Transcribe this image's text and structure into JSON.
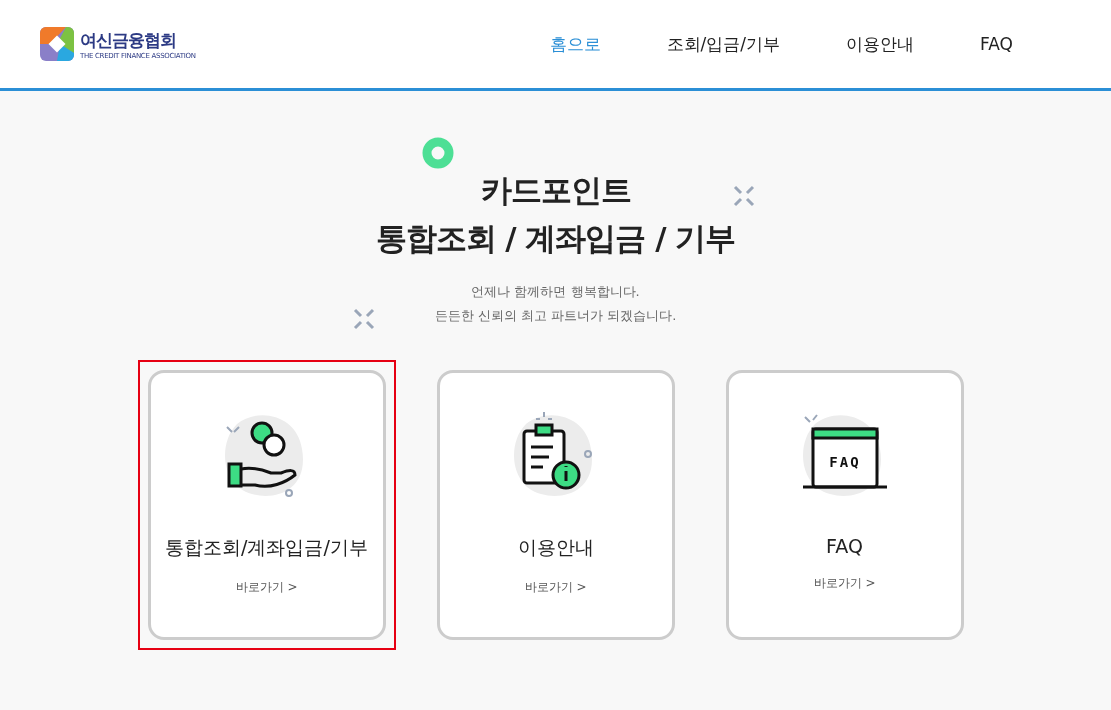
{
  "header": {
    "logo": {
      "name": "여신금융협회",
      "subtitle": "THE CREDIT FINANCE ASSOCIATION"
    },
    "nav": [
      {
        "label": "홈으로",
        "selected": true
      },
      {
        "label": "조회/입금/기부",
        "selected": false
      },
      {
        "label": "이용안내",
        "selected": false
      },
      {
        "label": "FAQ",
        "selected": false
      }
    ]
  },
  "hero": {
    "title_lines": [
      "카드포인트",
      "통합조회 / 계좌입금 / 기부"
    ],
    "subtitle_lines": [
      "언제나 함께하면 행복합니다.",
      "든든한 신뢰의 최고 파트너가 되겠습니다."
    ]
  },
  "cards": [
    {
      "kind": "coin",
      "title": "통합조회/계좌입금/기부",
      "link": "바로가기 >",
      "selected": true
    },
    {
      "kind": "clipboard",
      "title": "이용안내",
      "link": "바로가기 >",
      "selected": false
    },
    {
      "kind": "faq",
      "icon_label": "FAQ",
      "title": "FAQ",
      "link": "바로가기 >",
      "selected": false
    }
  ]
}
